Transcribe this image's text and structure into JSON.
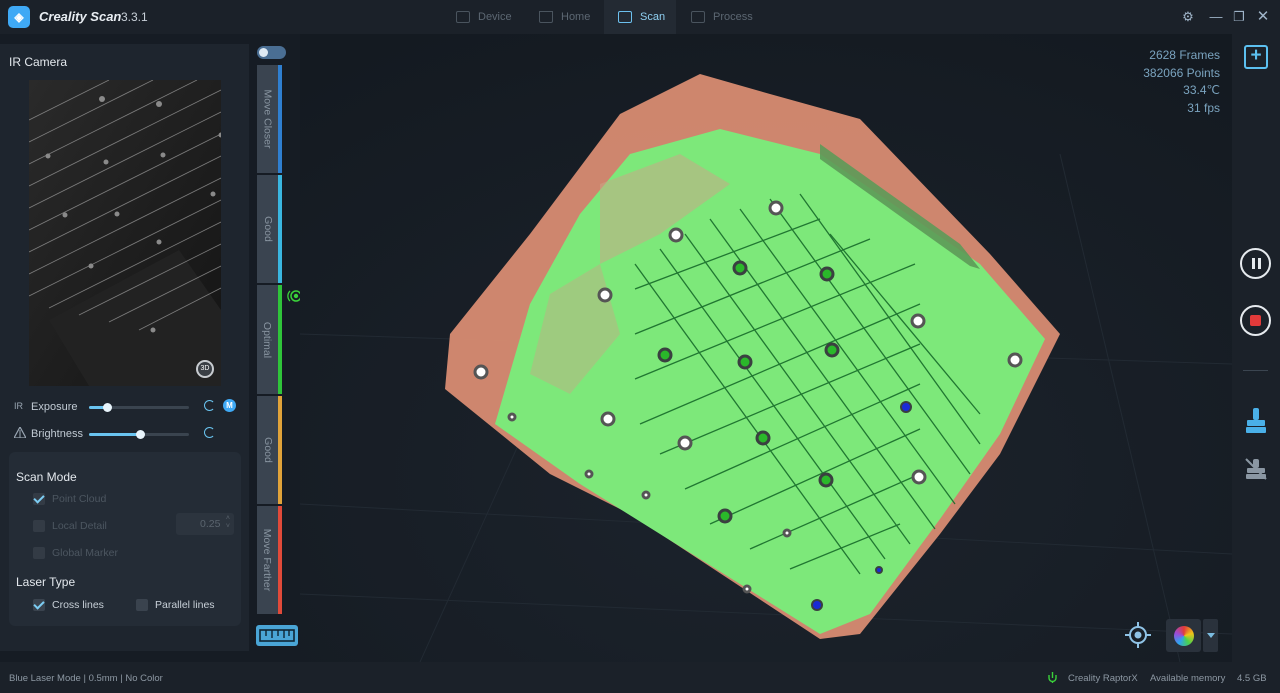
{
  "app": {
    "name": "Creality Scan",
    "version": "3.3.1"
  },
  "nav": {
    "tabs": [
      {
        "label": "Device"
      },
      {
        "label": "Home"
      },
      {
        "label": "Scan",
        "active": true
      },
      {
        "label": "Process"
      }
    ]
  },
  "ir_camera": {
    "title": "IR Camera",
    "exposure": {
      "prefix": "IR",
      "label": "Exposure",
      "level": 0.18
    },
    "brightness": {
      "prefix": "",
      "label": "Brightness",
      "level": 0.51
    },
    "mode_badge": "M"
  },
  "scan_mode": {
    "title": "Scan Mode",
    "options": [
      {
        "label": "Point Cloud",
        "checked": true
      },
      {
        "label": "Local Detail",
        "checked": false
      },
      {
        "label": "Global Marker",
        "checked": false
      }
    ],
    "detail_value": "0.25"
  },
  "laser_type": {
    "title": "Laser Type",
    "options": [
      {
        "label": "Cross lines",
        "checked": true
      },
      {
        "label": "Parallel lines",
        "checked": false
      }
    ]
  },
  "distance": {
    "segments": [
      {
        "label": "Move Closer",
        "color": "#2f7fd0"
      },
      {
        "label": "Good",
        "color": "#3ab6e0"
      },
      {
        "label": "Optimal",
        "color": "#2fc43a"
      },
      {
        "label": "Good",
        "color": "#e0a33a"
      },
      {
        "label": "Move Farther",
        "color": "#e04a3a"
      }
    ]
  },
  "stats": {
    "frames": {
      "value": "2628",
      "unit": "Frames"
    },
    "points": {
      "value": "382066",
      "unit": "Points"
    },
    "temperature": {
      "value": "33.4",
      "unit": "℃"
    },
    "fps": {
      "value": "31",
      "unit": "fps"
    }
  },
  "status": {
    "mode": "Blue Laser Mode | 0.5mm | No Color",
    "device": "Creality RaptorX",
    "memory_label": "Available memory",
    "memory_value": "4.5 GB"
  },
  "colors": {
    "accent": "#3fa9f5",
    "scan_green": "#7de87a",
    "scan_salmon": "#d88c72",
    "stop_red": "#e23a3a"
  }
}
